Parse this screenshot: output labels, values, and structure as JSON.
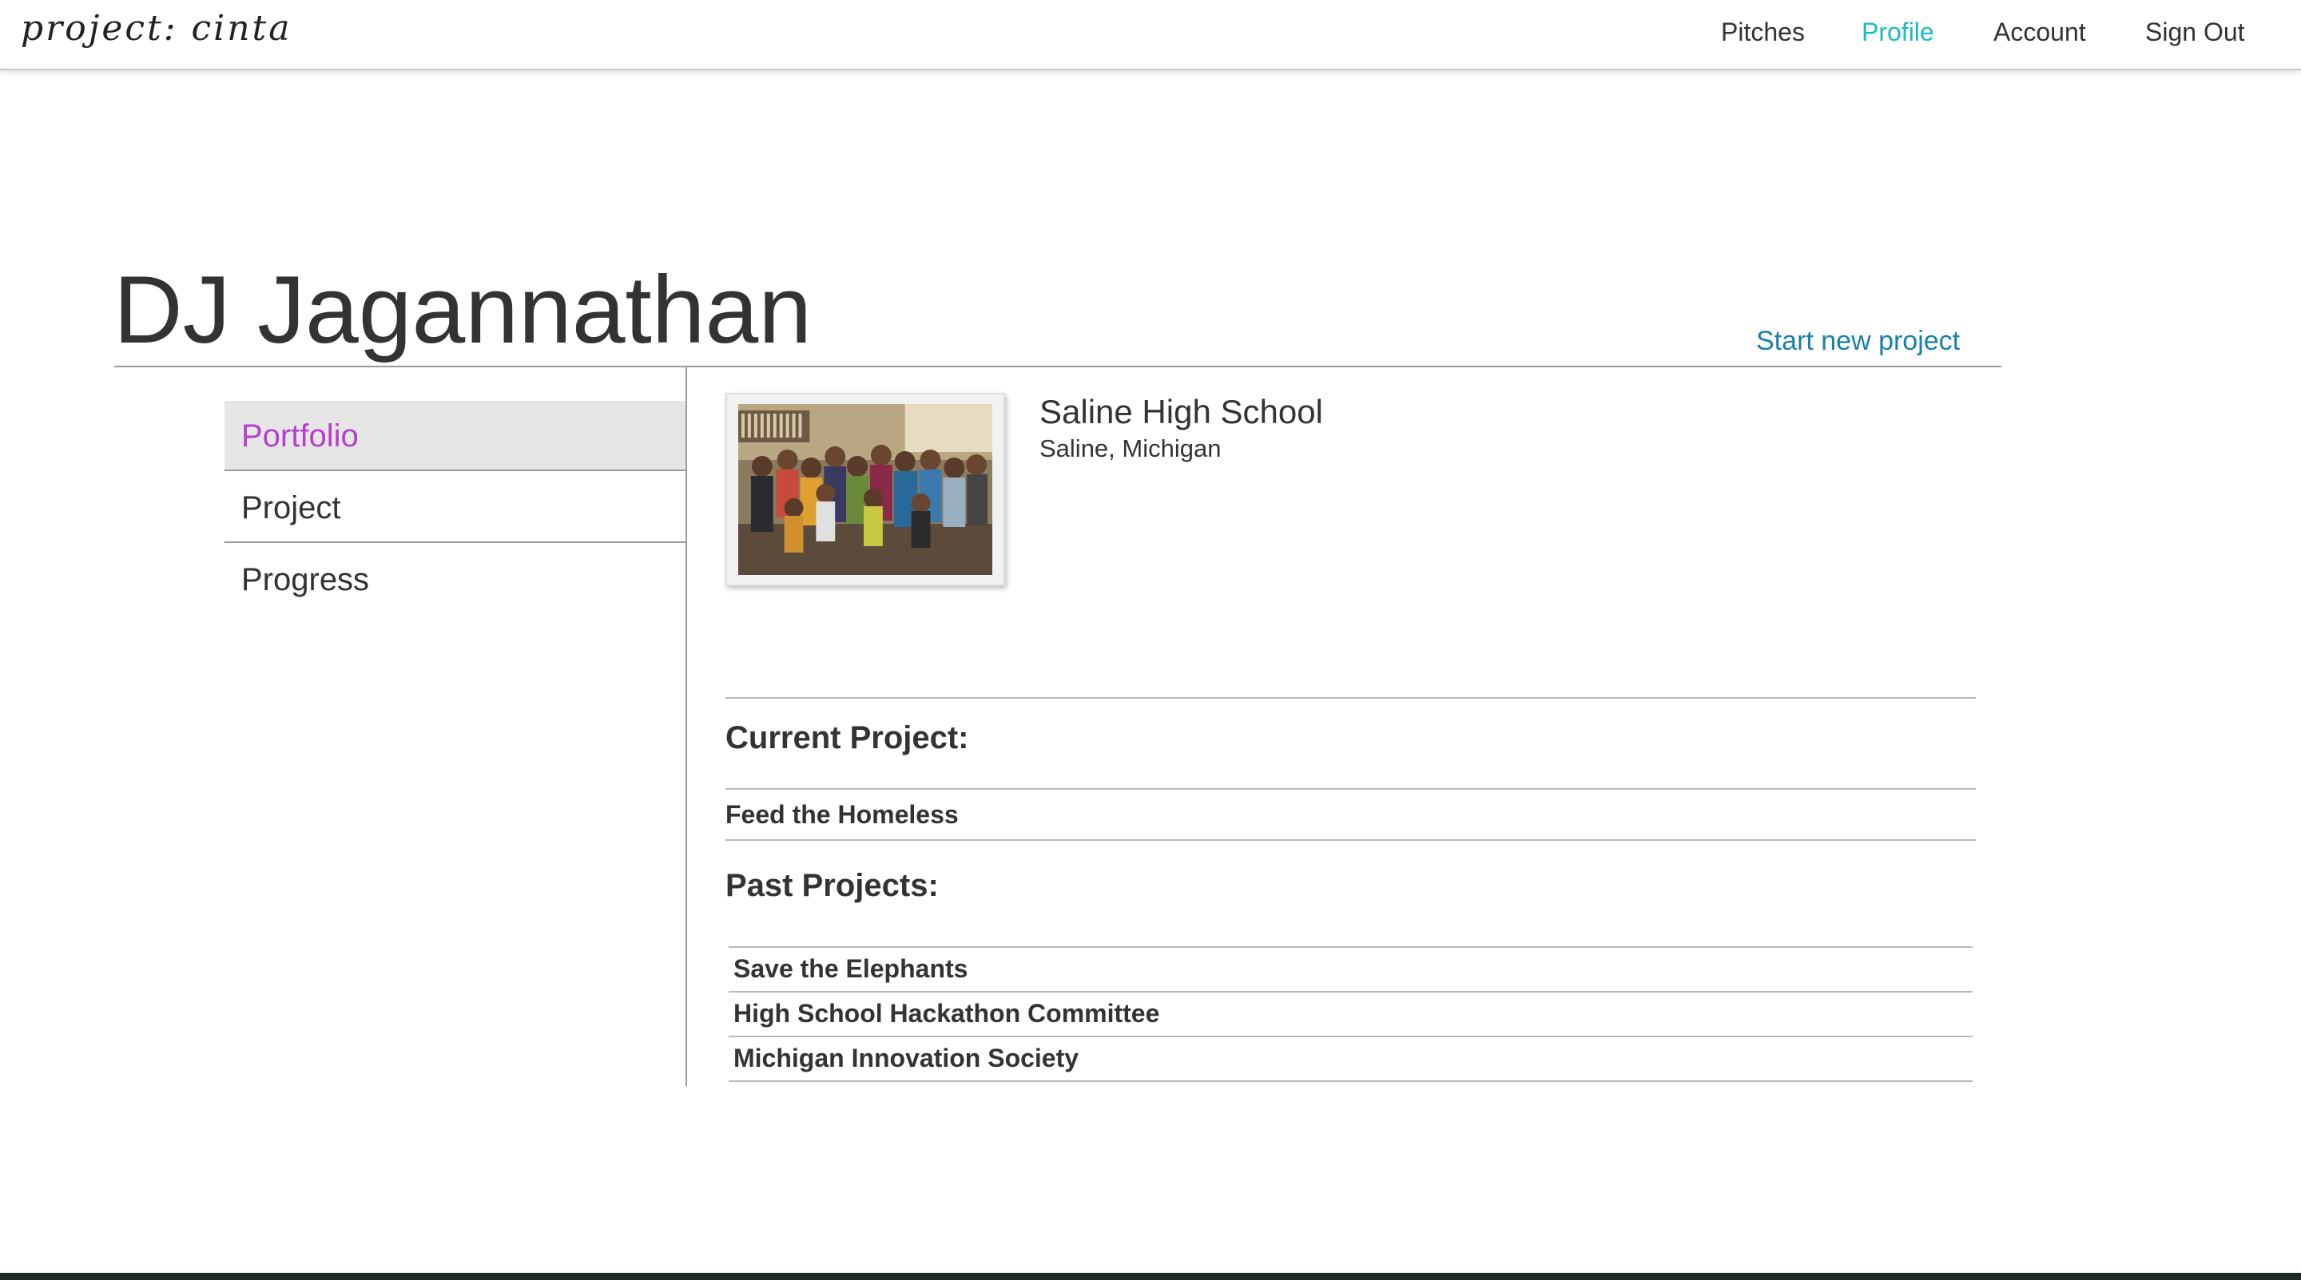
{
  "navbar": {
    "brand": "project: cinta",
    "links": [
      {
        "label": "Pitches",
        "active": false
      },
      {
        "label": "Profile",
        "active": true
      },
      {
        "label": "Account",
        "active": false
      },
      {
        "label": "Sign Out",
        "active": false
      }
    ],
    "active_color": "#1fb8c6"
  },
  "profile": {
    "name": "DJ Jagannathan",
    "start_project_label": "Start new project"
  },
  "side_menu": {
    "items": [
      {
        "label": "Portfolio",
        "active": true
      },
      {
        "label": "Project",
        "active": false
      },
      {
        "label": "Progress",
        "active": false
      }
    ],
    "active_color": "#b73fce"
  },
  "school": {
    "name": "Saline High School",
    "location": "Saline, Michigan"
  },
  "current_project": {
    "title": "Current Project:",
    "name": "Feed the Homeless"
  },
  "past_projects": {
    "title": "Past Projects:",
    "items": [
      "Save the Elephants",
      "High School Hackathon Committee",
      "Michigan Innovation Society"
    ]
  },
  "colors": {
    "link_blue": "#1a7fa8",
    "text": "#333333",
    "rule": "#9a9a9a"
  }
}
